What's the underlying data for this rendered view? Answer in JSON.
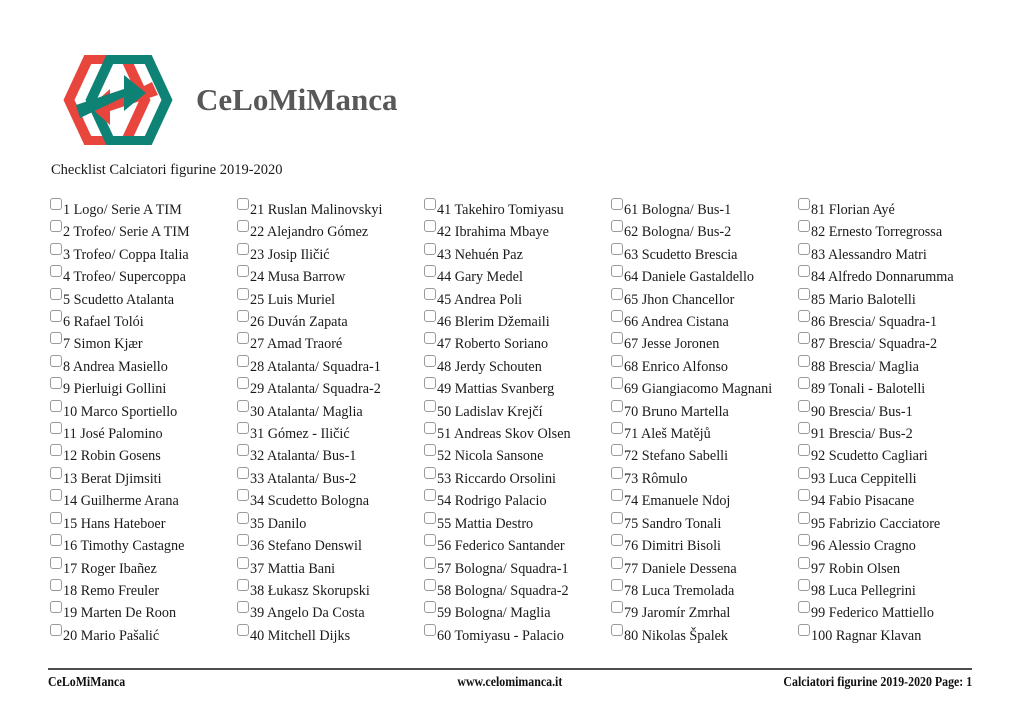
{
  "brand": {
    "wordmark": "CeLoMiManca",
    "logo_icon": "interlocking-hexagons-arrows-logo",
    "colors": {
      "red": "#e8453c",
      "teal": "#0e8274",
      "wordmark_gray": "#585858"
    }
  },
  "subtitle": "Checklist Calciatori figurine 2019-2020",
  "checklist": {
    "columns": [
      [
        "1 Logo/ Serie A TIM",
        "2 Trofeo/ Serie A TIM",
        "3 Trofeo/ Coppa Italia",
        "4 Trofeo/ Supercoppa",
        "5 Scudetto Atalanta",
        "6 Rafael Tolói",
        "7 Simon Kjær",
        "8 Andrea Masiello",
        "9 Pierluigi Gollini",
        "10 Marco Sportiello",
        "11 José Palomino",
        "12 Robin Gosens",
        "13 Berat Djimsiti",
        "14 Guilherme Arana",
        "15 Hans Hateboer",
        "16 Timothy Castagne",
        "17 Roger Ibañez",
        "18 Remo Freuler",
        "19 Marten De Roon",
        "20 Mario Pašalić"
      ],
      [
        "21 Ruslan Malinovskyi",
        "22 Alejandro Gómez",
        "23 Josip Iličić",
        "24 Musa Barrow",
        "25 Luis Muriel",
        "26 Duván Zapata",
        "27 Amad Traoré",
        "28 Atalanta/ Squadra-1",
        "29 Atalanta/ Squadra-2",
        "30 Atalanta/ Maglia",
        "31 Gómez - Iličić",
        "32 Atalanta/ Bus-1",
        "33 Atalanta/ Bus-2",
        "34 Scudetto Bologna",
        "35 Danilo",
        "36 Stefano Denswil",
        "37 Mattia Bani",
        "38 Łukasz Skorupski",
        "39 Angelo Da Costa",
        "40 Mitchell Dijks"
      ],
      [
        "41 Takehiro Tomiyasu",
        "42 Ibrahima Mbaye",
        "43 Nehuén Paz",
        "44 Gary Medel",
        "45 Andrea Poli",
        "46 Blerim Džemaili",
        "47 Roberto Soriano",
        "48 Jerdy Schouten",
        "49 Mattias Svanberg",
        "50 Ladislav Krejčí",
        "51 Andreas Skov Olsen",
        "52 Nicola Sansone",
        "53 Riccardo Orsolini",
        "54 Rodrigo Palacio",
        "55 Mattia Destro",
        "56 Federico Santander",
        "57 Bologna/ Squadra-1",
        "58 Bologna/ Squadra-2",
        "59 Bologna/ Maglia",
        "60 Tomiyasu - Palacio"
      ],
      [
        "61 Bologna/ Bus-1",
        "62 Bologna/ Bus-2",
        "63 Scudetto Brescia",
        "64 Daniele Gastaldello",
        "65 Jhon Chancellor",
        "66 Andrea Cistana",
        "67 Jesse Joronen",
        "68 Enrico Alfonso",
        "69 Giangiacomo Magnani",
        "70 Bruno Martella",
        "71 Aleš Matějů",
        "72 Stefano Sabelli",
        "73 Rômulo",
        "74 Emanuele Ndoj",
        "75 Sandro Tonali",
        "76 Dimitri Bisoli",
        "77 Daniele Dessena",
        "78 Luca Tremolada",
        "79 Jaromír Zmrhal",
        "80 Nikolas Špalek"
      ],
      [
        "81 Florian Ayé",
        "82 Ernesto Torregrossa",
        "83 Alessandro Matri",
        "84 Alfredo Donnarumma",
        "85 Mario Balotelli",
        "86 Brescia/ Squadra-1",
        "87 Brescia/ Squadra-2",
        "88 Brescia/ Maglia",
        "89 Tonali - Balotelli",
        "90 Brescia/ Bus-1",
        "91 Brescia/ Bus-2",
        "92 Scudetto Cagliari",
        "93 Luca Ceppitelli",
        "94 Fabio Pisacane",
        "95 Fabrizio Cacciatore",
        "96 Alessio Cragno",
        "97 Robin Olsen",
        "98 Luca Pellegrini",
        "99 Federico Mattiello",
        "100 Ragnar Klavan"
      ]
    ]
  },
  "footer": {
    "left": "CeLoMiManca",
    "center": "www.celomimanca.it",
    "right": "Calciatori figurine 2019-2020 Page: 1"
  }
}
